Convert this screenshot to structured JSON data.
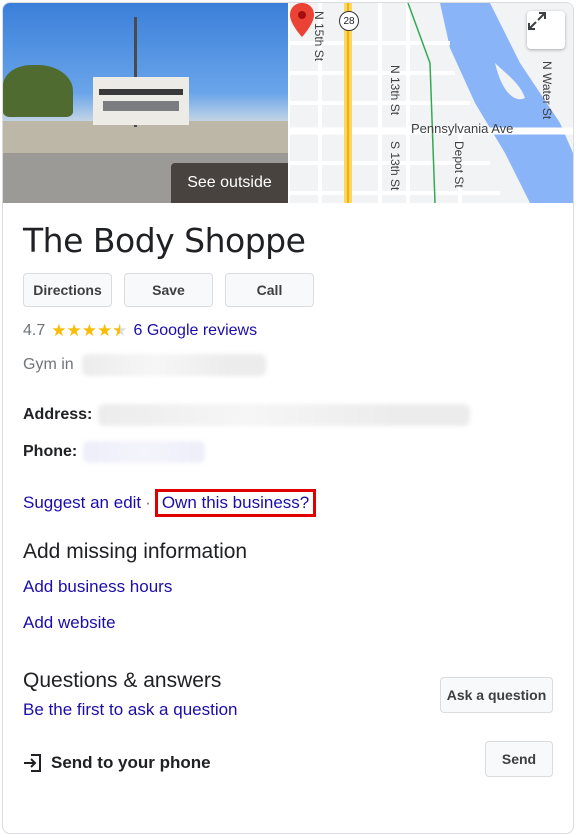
{
  "header": {
    "see_outside_label": "See outside",
    "map_labels": {
      "route_number": "28",
      "n15": "N 15th St",
      "n13": "N 13th St",
      "s13": "S 13th St",
      "depot": "Depot St",
      "water": "N Water St",
      "pennsylvania": "Pennsylvania Ave"
    }
  },
  "business": {
    "name": "The Body Shoppe",
    "rating": "4.7",
    "star_count": 4.5,
    "reviews_link": "6 Google reviews",
    "category_prefix": "Gym in",
    "address_label": "Address:",
    "phone_label": "Phone:"
  },
  "actions": {
    "directions": "Directions",
    "save": "Save",
    "call": "Call"
  },
  "edit": {
    "suggest": "Suggest an edit",
    "separator": "·",
    "own": "Own this business?"
  },
  "missing": {
    "heading": "Add missing information",
    "hours": "Add business hours",
    "website": "Add website"
  },
  "qa": {
    "heading": "Questions & answers",
    "first": "Be the first to ask a question",
    "ask_button": "Ask a question"
  },
  "phone_send": {
    "label": "Send to your phone",
    "button": "Send"
  },
  "colors": {
    "link": "#1a0dab",
    "star": "#fbbc04",
    "highlight_box": "#e00000",
    "pin": "#ea4335"
  }
}
